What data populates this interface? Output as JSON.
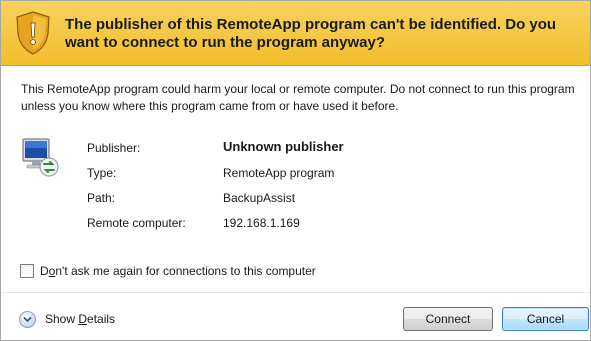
{
  "header": {
    "warning_text": "The publisher of this RemoteApp program can't be identified. Do you want to connect to run the program anyway?",
    "icon": "warning-shield-icon",
    "bg_color": "#f5c842"
  },
  "description": "This RemoteApp program could harm your local or remote computer. Do not connect to run this program unless you know where this program came from or have used it before.",
  "details": {
    "icon": "remote-computer-icon",
    "rows": [
      {
        "label": "Publisher:",
        "value": "Unknown publisher"
      },
      {
        "label": "Type:",
        "value": "RemoteApp program"
      },
      {
        "label": "Path:",
        "value": "BackupAssist"
      },
      {
        "label": "Remote computer:",
        "value": "192.168.1.169"
      }
    ]
  },
  "checkbox": {
    "label_prefix": "D",
    "label_accel": "o",
    "label_rest": "n't ask me again for connections to this computer",
    "checked": false
  },
  "footer": {
    "show_details_prefix": "Show ",
    "show_details_accel": "D",
    "show_details_rest": "etails",
    "connect_label": "Connect",
    "cancel_label": "Cancel"
  }
}
